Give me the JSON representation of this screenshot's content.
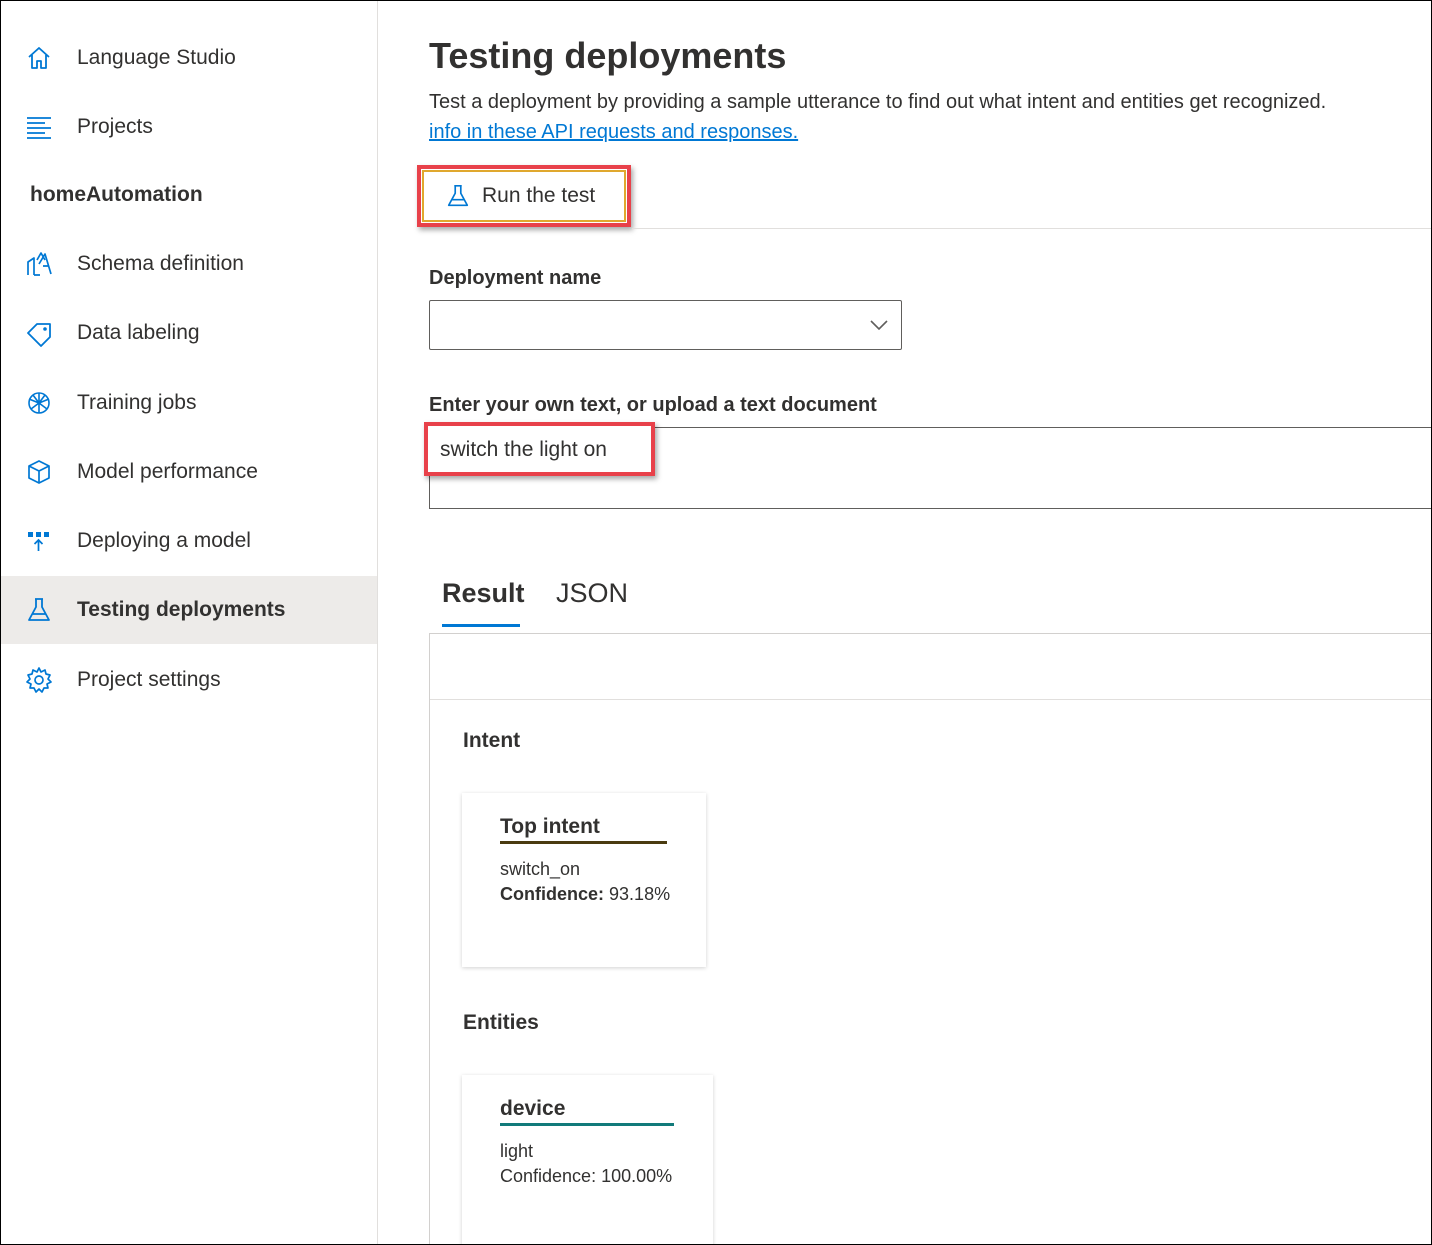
{
  "sidebar": {
    "top_items": [
      {
        "label": "Language Studio",
        "icon": "home-icon"
      },
      {
        "label": "Projects",
        "icon": "list-icon"
      }
    ],
    "project_name": "homeAutomation",
    "items": [
      {
        "label": "Schema definition",
        "icon": "schema-icon"
      },
      {
        "label": "Data labeling",
        "icon": "tag-icon"
      },
      {
        "label": "Training jobs",
        "icon": "brain-icon"
      },
      {
        "label": "Model performance",
        "icon": "cube-icon"
      },
      {
        "label": "Deploying a model",
        "icon": "deploy-icon"
      },
      {
        "label": "Testing deployments",
        "icon": "flask-icon",
        "active": true
      },
      {
        "label": "Project settings",
        "icon": "gear-icon"
      }
    ]
  },
  "page": {
    "title": "Testing deployments",
    "description": "Test a deployment by providing a sample utterance to find out what intent and entities get recognized.",
    "link_text": "info in these API requests and responses."
  },
  "toolbar": {
    "run_label": "Run the test",
    "run_icon": "flask-icon"
  },
  "form": {
    "deployment_label": "Deployment name",
    "deployment_value": "",
    "text_label": "Enter your own text, or upload a text document",
    "text_value": "switch the light on"
  },
  "tabs": {
    "result": "Result",
    "json": "JSON"
  },
  "results": {
    "intent_heading": "Intent",
    "intent_card": {
      "title": "Top intent",
      "value": "switch_on",
      "confidence_label": "Confidence:",
      "confidence_value": "93.18%"
    },
    "entities_heading": "Entities",
    "entity_card": {
      "title": "device",
      "value": "light",
      "confidence_text": "Confidence: 100.00%"
    }
  },
  "colors": {
    "accent": "#0078d4",
    "highlight_red": "#e8414a",
    "intent_bar": "#4a3b10",
    "entity_bar": "#117a7a"
  }
}
